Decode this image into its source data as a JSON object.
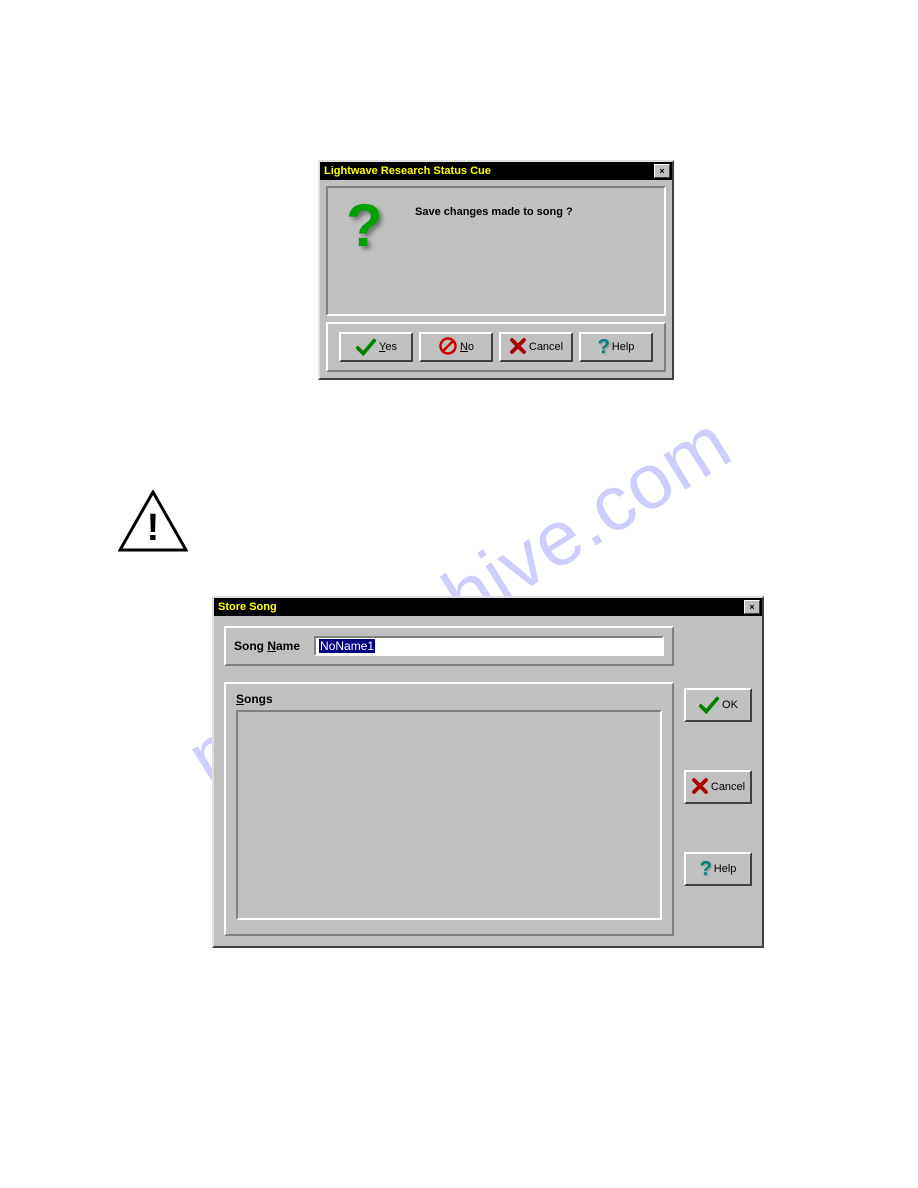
{
  "dialog1": {
    "title": "Lightwave Research Status Cue",
    "message": "Save changes made to song ?",
    "buttons": {
      "yes": "Yes",
      "no": "No",
      "cancel": "Cancel",
      "help": "Help"
    }
  },
  "dialog2": {
    "title": "Store Song",
    "song_name_label": "Song Name",
    "song_name_value": "NoName1",
    "songs_label": "Songs",
    "buttons": {
      "ok": "OK",
      "cancel": "Cancel",
      "help": "Help"
    }
  },
  "watermark": "manualshive.com"
}
